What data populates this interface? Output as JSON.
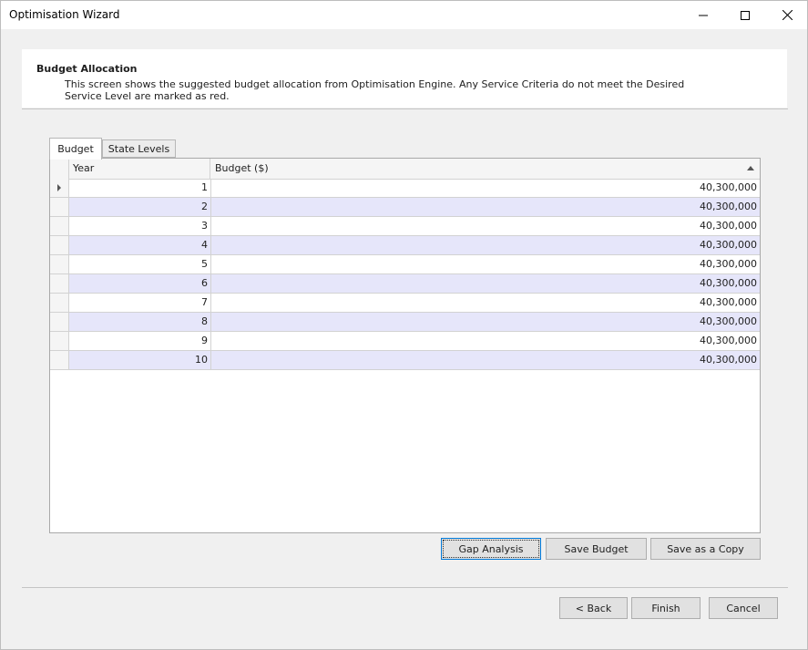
{
  "window": {
    "title": "Optimisation Wizard"
  },
  "header": {
    "title": "Budget Allocation",
    "description": "This screen shows the suggested budget allocation from Optimisation Engine. Any Service Criteria do not meet the Desired Service Level are marked as red."
  },
  "tabs": [
    {
      "label": "Budget",
      "active": true
    },
    {
      "label": "State Levels",
      "active": false
    }
  ],
  "grid": {
    "columns": [
      "Year",
      "Budget ($)"
    ],
    "sort_column": "Budget ($)",
    "sort_direction": "ascending",
    "rows": [
      {
        "year": "1",
        "budget": "40,300,000"
      },
      {
        "year": "2",
        "budget": "40,300,000"
      },
      {
        "year": "3",
        "budget": "40,300,000"
      },
      {
        "year": "4",
        "budget": "40,300,000"
      },
      {
        "year": "5",
        "budget": "40,300,000"
      },
      {
        "year": "6",
        "budget": "40,300,000"
      },
      {
        "year": "7",
        "budget": "40,300,000"
      },
      {
        "year": "8",
        "budget": "40,300,000"
      },
      {
        "year": "9",
        "budget": "40,300,000"
      },
      {
        "year": "10",
        "budget": "40,300,000"
      }
    ],
    "alternate_row_color": "#e6e6fa"
  },
  "actions": {
    "gap_analysis": "Gap Analysis",
    "save_budget": "Save Budget",
    "save_as_copy": "Save as a Copy"
  },
  "footer": {
    "back": "< Back",
    "finish": "Finish",
    "cancel": "Cancel"
  },
  "colors": {
    "focus_border": "#0078d7",
    "window_bg": "#f0f0f0"
  }
}
